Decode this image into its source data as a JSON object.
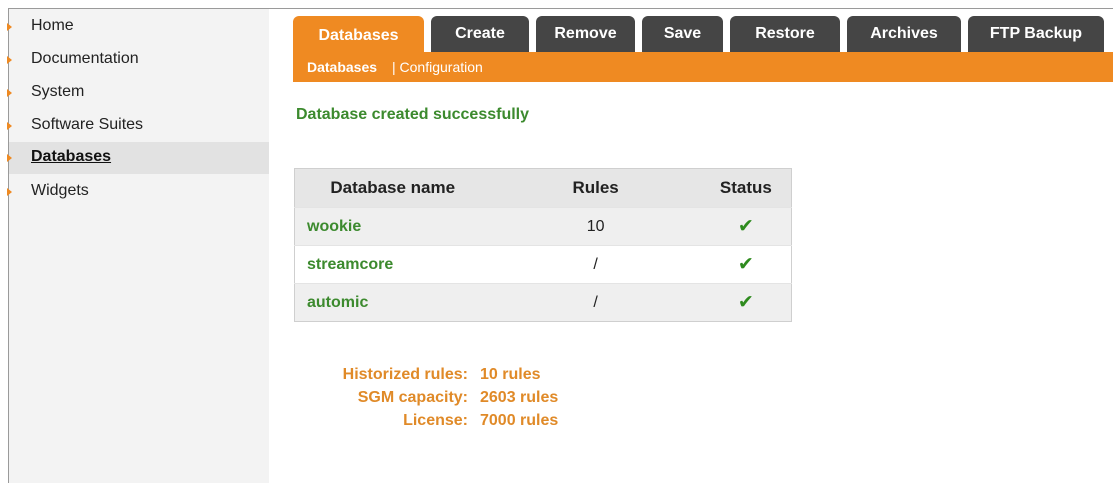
{
  "sidebar": {
    "items": [
      {
        "label": "Home"
      },
      {
        "label": "Documentation"
      },
      {
        "label": "System"
      },
      {
        "label": "Software Suites"
      },
      {
        "label": "Databases"
      },
      {
        "label": "Widgets"
      }
    ],
    "active": "Databases"
  },
  "tabs": [
    {
      "label": "Databases"
    },
    {
      "label": "Create"
    },
    {
      "label": "Remove"
    },
    {
      "label": "Save"
    },
    {
      "label": "Restore"
    },
    {
      "label": "Archives"
    },
    {
      "label": "FTP Backup"
    }
  ],
  "subnav": {
    "items": [
      {
        "label": "Databases"
      },
      {
        "label": "| Configuration"
      }
    ]
  },
  "message": "Database created successfully",
  "table": {
    "headers": [
      "Database name",
      "Rules",
      "Status"
    ],
    "rows": [
      {
        "name": "wookie",
        "rules": "10",
        "status": "✔"
      },
      {
        "name": "streamcore",
        "rules": "/",
        "status": "✔"
      },
      {
        "name": "automic",
        "rules": "/",
        "status": "✔"
      }
    ]
  },
  "summary": {
    "historized_label": "Historized rules:",
    "historized_value": "10 rules",
    "capacity_label": "SGM capacity:",
    "capacity_value": "2603 rules",
    "license_label": "License:",
    "license_value": "7000 rules"
  },
  "colors": {
    "accent": "#ef8a22",
    "tab_dark": "#454545",
    "success_green": "#3c8a2e",
    "summary_orange": "#e08a28"
  }
}
